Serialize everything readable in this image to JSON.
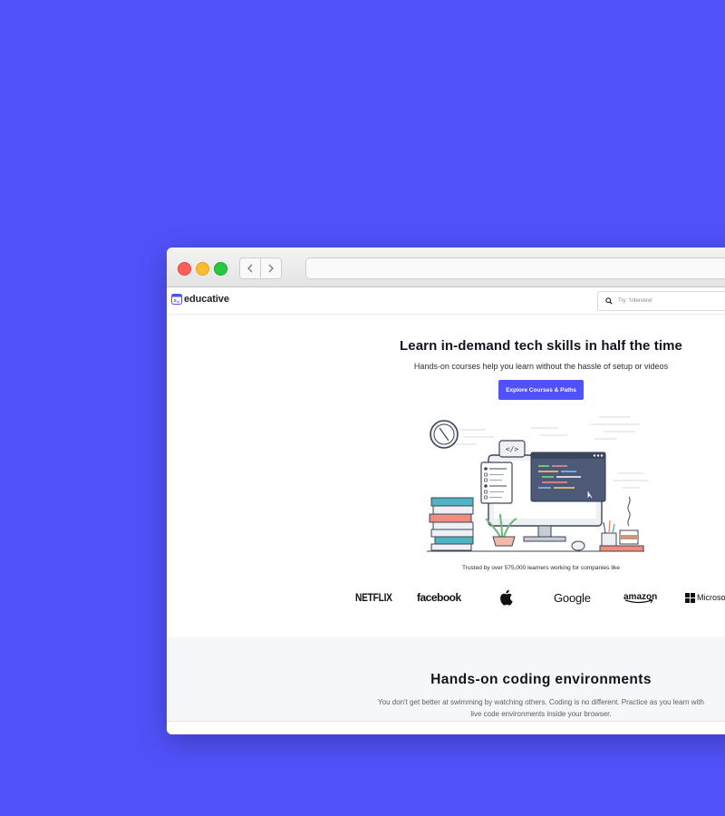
{
  "browser": {
    "back_icon": "chevron-left-icon",
    "forward_icon": "chevron-right-icon",
    "url": ""
  },
  "site": {
    "logo_text": "educative",
    "search_placeholder": "Try: 'Interview'"
  },
  "hero": {
    "title": "Learn in-demand tech skills in half the time",
    "subtitle": "Hands-on courses help you learn without the hassle of setup or videos",
    "cta_label": "Explore Courses & Paths"
  },
  "trust": {
    "text": "Trusted by over 575,000 learners working for companies like",
    "companies": [
      "NETFLIX",
      "facebook",
      "Apple",
      "Google",
      "amazon",
      "Microsoft"
    ]
  },
  "section2": {
    "title": "Hands-on coding environments",
    "description": "You don't get better at swimming by watching others. Coding is no different. Practice as you learn with live code environments inside your browser."
  },
  "colors": {
    "brand": "#5151f9",
    "background": "#5151f9"
  }
}
